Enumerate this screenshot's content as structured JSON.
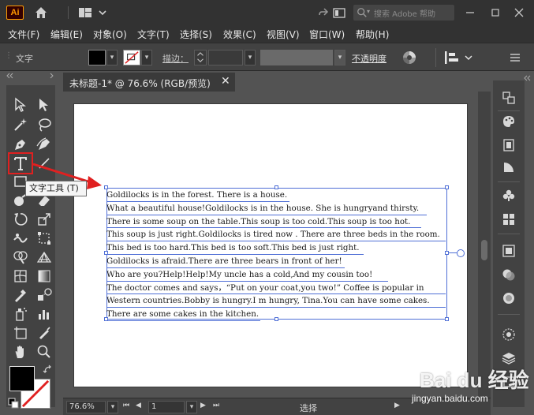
{
  "titlebar": {
    "app_logo": "Ai",
    "search_placeholder": "搜索 Adobe 帮助"
  },
  "menu": {
    "items": [
      "文件(F)",
      "编辑(E)",
      "对象(O)",
      "文字(T)",
      "选择(S)",
      "效果(C)",
      "视图(V)",
      "窗口(W)",
      "帮助(H)"
    ]
  },
  "controlbar": {
    "tool_label": "文字",
    "stroke_label": "描边：",
    "opacity_label": "不透明度"
  },
  "document": {
    "tab_title": "未标题-1* @ 76.6% (RGB/预览)",
    "close_glyph": "✕",
    "text_lines": [
      "Goldilocks is in the forest. There is a house.",
      "What a beautiful house!Goldilocks is in the house. She is hungryand thirsty.",
      "There is some soup on the table.This soup is too cold.This soup is too hot.",
      "This soup is just right.Goldilocks is tired now . There are three beds in the room.",
      "This bed is too hard.This bed is too soft.This bed is just right.",
      "Goldilocks is afraid.There are three bears in front of her!",
      "Who are you?Help!Help!My uncle has a cold,And my cousin too!",
      "The doctor comes and says，“Put on your coat,you two!” Coffee is popular in",
      "Western countries.Bobby is hungry.I m hungry, Tina.You can have some cakes.",
      "There are some cakes in the kitchen."
    ]
  },
  "tooltip": {
    "text": "文字工具 (T)"
  },
  "statusbar": {
    "zoom": "76.6%",
    "artboard_number": "1",
    "status_text": "选择"
  },
  "watermark": {
    "logo": "Bai du 经验",
    "url": "jingyan.baidu.com"
  },
  "colors": {
    "accent_red": "#e02020",
    "selection_blue": "#4f6fd6",
    "ai_orange": "#ff9a00"
  }
}
